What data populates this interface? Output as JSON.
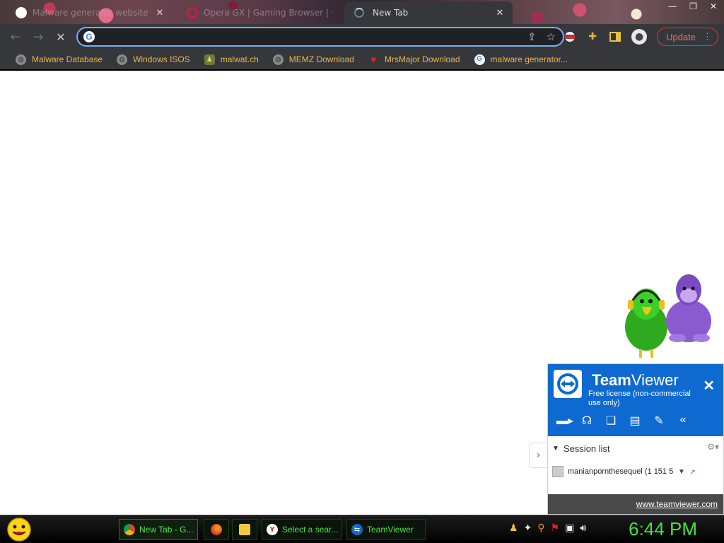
{
  "browser": {
    "tabs": [
      {
        "title": "Malware generator website - Go",
        "active": false
      },
      {
        "title": "Opera GX | Gaming Browser | O",
        "active": false
      },
      {
        "title": "New Tab",
        "active": true
      }
    ],
    "omnibox": {
      "value": "",
      "placeholder": ""
    },
    "update_label": "Update",
    "bookmarks": [
      {
        "label": "Malware Database",
        "icon": "globe-icon"
      },
      {
        "label": "Windows ISOS",
        "icon": "globe-icon"
      },
      {
        "label": "malwat.ch",
        "icon": "malwatch-icon"
      },
      {
        "label": "MEMZ Download",
        "icon": "globe-icon"
      },
      {
        "label": "MrsMajor Download",
        "icon": "heart-icon"
      },
      {
        "label": "malware generator...",
        "icon": "google-icon"
      }
    ]
  },
  "teamviewer": {
    "brand_bold": "Team",
    "brand_light": "Viewer",
    "license": "Free license (non-commercial use only)",
    "session_list_label": "Session list",
    "session_item": "manianpornthesequel (1 151 5",
    "footer_link": "www.teamviewer.com",
    "brand_color": "#0e6ad1"
  },
  "taskbar": {
    "tasks": [
      {
        "label": "New Tab - G...",
        "icon": "chrome-icon"
      },
      {
        "label": "",
        "icon": "firefox-icon"
      },
      {
        "label": "",
        "icon": "folder-icon"
      },
      {
        "label": "Select a sear...",
        "icon": "yandex-icon"
      },
      {
        "label": "TeamViewer",
        "icon": "teamviewer-icon"
      }
    ],
    "clock": "6:44 PM",
    "accent": "#3ee63e"
  }
}
